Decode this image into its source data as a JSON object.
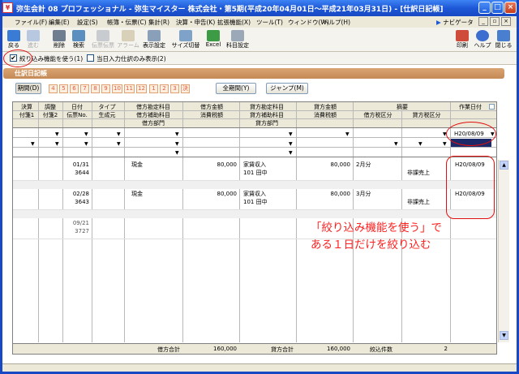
{
  "window": {
    "title": "弥生会計 08 プロフェッショナル - 弥生マイスター 株式会社・第5期(平成20年04月01日～平成21年03月31日) - [仕訳日記帳]"
  },
  "menu": [
    "ファイル(F)",
    "編集(E)",
    "設定(S)",
    "帳簿・伝票(C)",
    "集計(R)",
    "決算・申告(K)",
    "拡張機能(X)",
    "ツール(T)",
    "ウィンドウ(W)",
    "ヘルプ(H)"
  ],
  "navi_label": "ナビゲータ",
  "toolbar": {
    "back": "戻る",
    "forward": "進む",
    "delete": "削除",
    "search": "検索",
    "fukushi": "伝票伝票",
    "alarm": "アラーム",
    "display_settings": "表示設定",
    "size": "サイズ切替",
    "excel": "Excel",
    "account": "科目設定",
    "print": "印刷",
    "help": "ヘルプ",
    "close": "閉じる"
  },
  "options": {
    "filter_label": "絞り込み機能を使う(1)",
    "filter_checked": true,
    "today_label": "当日入力仕訳のみ表示(2)",
    "today_checked": false
  },
  "panel_title": "仕訳日記帳",
  "period": {
    "label": "期間(D)",
    "months": [
      "4",
      "5",
      "6",
      "7",
      "8",
      "9",
      "10",
      "11",
      "12",
      "1",
      "2",
      "3",
      "決"
    ],
    "all_button": "全期間(Y)",
    "jump_button": "ジャンプ(M)"
  },
  "headers": {
    "kessai": "決算",
    "choseki": "調整",
    "date": "日付",
    "type": "タイプ",
    "debit_acct": "借方勘定科目",
    "debit_amt": "借方金額",
    "credit_acct": "貸方勘定科目",
    "credit_amt": "貸方金額",
    "memo": "摘要",
    "work_date": "作業日付",
    "fusen1": "付箋1",
    "fusen2": "付箋2",
    "denpyo": "伝票No.",
    "origin": "生成元",
    "debit_sub": "借方補助科目",
    "debit_tax": "消費税額",
    "credit_sub": "貸方補助科目",
    "credit_tax": "消費税額",
    "debit_taxcat": "借方税区分",
    "credit_taxcat": "貸方税区分",
    "debit_dept": "借方部門",
    "credit_dept": "貸方部門"
  },
  "filter_work_date": "H20/08/09",
  "rows": [
    {
      "date": "01/31",
      "no": "3644",
      "debit": "現金",
      "amount": "80,000",
      "credit": "家賃収入",
      "credit_sub": "101 田中",
      "credit_amount": "80,000",
      "memo": "2月分",
      "taxcat": "非課売上",
      "work_date": "H20/08/09"
    },
    {
      "date": "02/28",
      "no": "3643",
      "debit": "現金",
      "amount": "80,000",
      "credit": "家賃収入",
      "credit_sub": "101 田中",
      "credit_amount": "80,000",
      "memo": "3月分",
      "taxcat": "非課売上",
      "work_date": "H20/08/09"
    },
    {
      "date": "09/21",
      "no": "3727"
    }
  ],
  "footer": {
    "debit_total_label": "借方合計",
    "debit_total": "160,000",
    "credit_total_label": "貸方合計",
    "credit_total": "160,000",
    "count_label": "絞込件数",
    "count": "2"
  },
  "annotation": {
    "line1": "「絞り込み機能を使う」で",
    "line2": "ある１日だけを絞り込む"
  },
  "colors": {
    "title_blue": "#1e58d6",
    "annotation_red": "#ff2020",
    "panel_brown": "#c58a56"
  }
}
